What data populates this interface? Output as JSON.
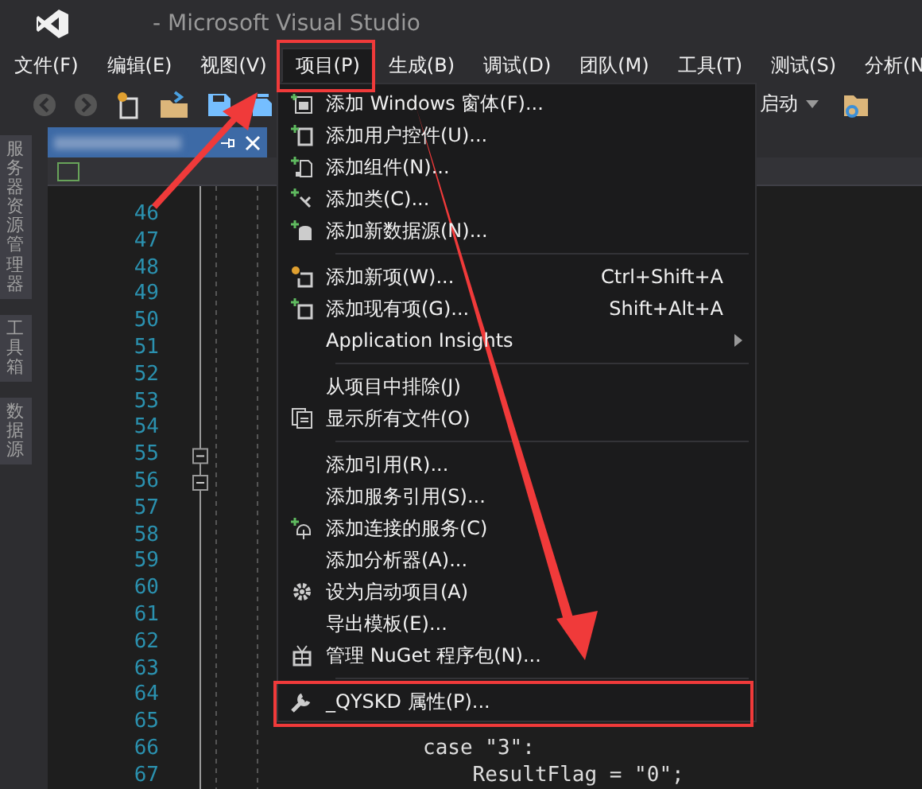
{
  "window": {
    "title": "- Microsoft Visual Studio"
  },
  "menu_bar": [
    {
      "label": "文件(F)",
      "selected": false
    },
    {
      "label": "编辑(E)",
      "selected": false
    },
    {
      "label": "视图(V)",
      "selected": false
    },
    {
      "label": "项目(P)",
      "selected": true
    },
    {
      "label": "生成(B)",
      "selected": false
    },
    {
      "label": "调试(D)",
      "selected": false
    },
    {
      "label": "团队(M)",
      "selected": false
    },
    {
      "label": "工具(T)",
      "selected": false
    },
    {
      "label": "测试(S)",
      "selected": false
    },
    {
      "label": "分析(N",
      "selected": false
    }
  ],
  "toolbar": {
    "start_label": "启动"
  },
  "side_tabs": [
    {
      "label": "服务器资源管理器"
    },
    {
      "label": "工具箱"
    },
    {
      "label": "数据源"
    }
  ],
  "editor": {
    "lines": [
      {
        "number": "46"
      },
      {
        "number": "47"
      },
      {
        "number": "48"
      },
      {
        "number": "49"
      },
      {
        "number": "50"
      },
      {
        "number": "51"
      },
      {
        "number": "52"
      },
      {
        "number": "53"
      },
      {
        "number": "54"
      },
      {
        "number": "55",
        "foldable": true
      },
      {
        "number": "56",
        "foldable": true
      },
      {
        "number": "57"
      },
      {
        "number": "58"
      },
      {
        "number": "59"
      },
      {
        "number": "60"
      },
      {
        "number": "61"
      },
      {
        "number": "62"
      },
      {
        "number": "63"
      },
      {
        "number": "64"
      },
      {
        "number": "65"
      },
      {
        "number": "66",
        "code": "case \"3\":"
      },
      {
        "number": "67",
        "code": "    ResultFlag = \"0\";"
      }
    ]
  },
  "project_menu": [
    {
      "kind": "item",
      "label": "添加 Windows 窗体(F)..."
    },
    {
      "kind": "item",
      "label": "添加用户控件(U)..."
    },
    {
      "kind": "item",
      "label": "添加组件(N)..."
    },
    {
      "kind": "item",
      "label": "添加类(C)..."
    },
    {
      "kind": "item",
      "label": "添加新数据源(N)..."
    },
    {
      "kind": "separator"
    },
    {
      "kind": "item",
      "label": "添加新项(W)...",
      "shortcut": "Ctrl+Shift+A"
    },
    {
      "kind": "item",
      "label": "添加现有项(G)...",
      "shortcut": "Shift+Alt+A"
    },
    {
      "kind": "item",
      "label": "Application Insights",
      "submenu": true
    },
    {
      "kind": "separator"
    },
    {
      "kind": "item",
      "label": "从项目中排除(J)"
    },
    {
      "kind": "item",
      "label": "显示所有文件(O)"
    },
    {
      "kind": "separator"
    },
    {
      "kind": "item",
      "label": "添加引用(R)..."
    },
    {
      "kind": "item",
      "label": "添加服务引用(S)..."
    },
    {
      "kind": "item",
      "label": "添加连接的服务(C)"
    },
    {
      "kind": "item",
      "label": "添加分析器(A)..."
    },
    {
      "kind": "item",
      "label": "设为启动项目(A)"
    },
    {
      "kind": "item",
      "label": "导出模板(E)..."
    },
    {
      "kind": "item",
      "label": "管理 NuGet 程序包(N)..."
    },
    {
      "kind": "separator"
    },
    {
      "kind": "item",
      "label": "_QYSKD 属性(P)..."
    }
  ]
}
